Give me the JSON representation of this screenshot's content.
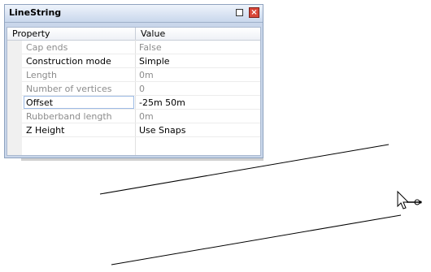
{
  "window": {
    "title": "LineString"
  },
  "grid": {
    "headers": {
      "property": "Property",
      "value": "Value"
    },
    "rows": [
      {
        "property": "Cap ends",
        "value": "False",
        "enabled": false
      },
      {
        "property": "Construction mode",
        "value": "Simple",
        "enabled": true
      },
      {
        "property": "Length",
        "value": "0m",
        "enabled": false
      },
      {
        "property": "Number of vertices",
        "value": "0",
        "enabled": false
      },
      {
        "property": "Offset",
        "value": "-25m 50m",
        "enabled": true
      },
      {
        "property": "Rubberband length",
        "value": "0m",
        "enabled": false
      },
      {
        "property": "Z Height",
        "value": "Use Snaps",
        "enabled": true
      }
    ]
  },
  "icons": {
    "restore": "restore-window-icon",
    "close": "close-icon",
    "cursor": "move-pointer-cursor-icon"
  },
  "colors": {
    "close_button": "#d9473a",
    "panel_frame": "#c9d6ea",
    "disabled_text": "#8c8c8c"
  }
}
